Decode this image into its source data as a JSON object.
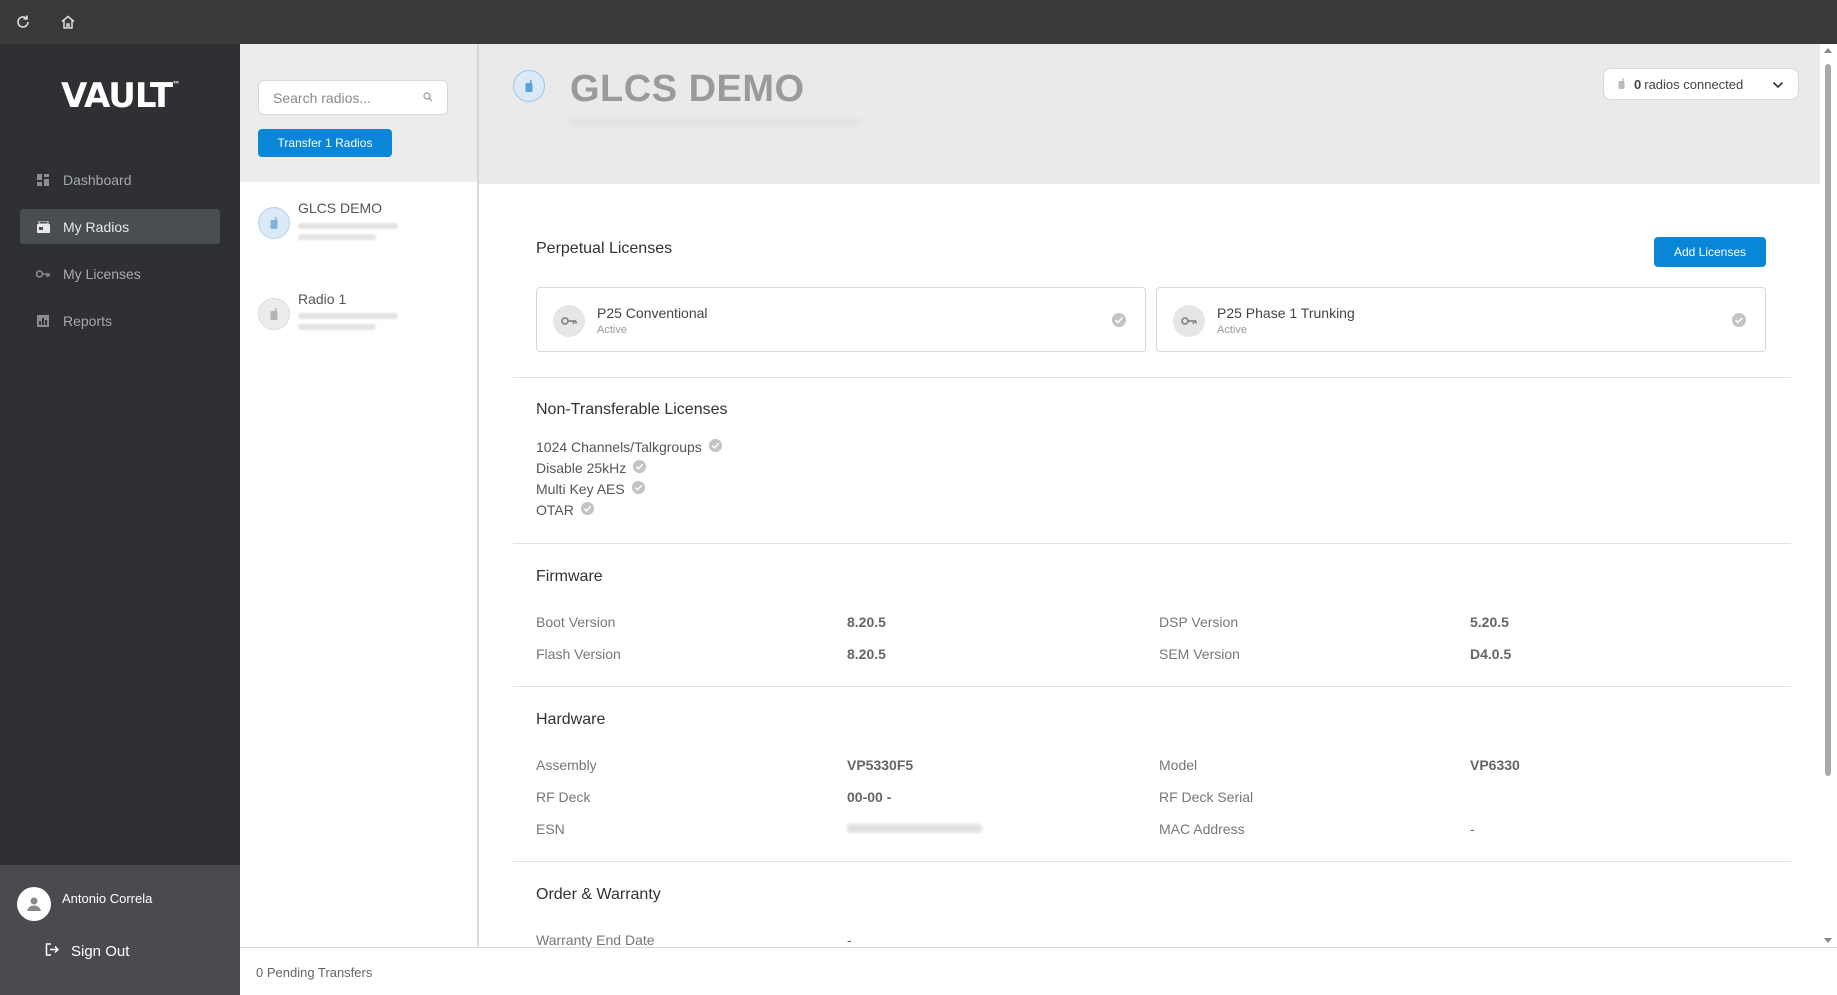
{
  "sidebar": {
    "logo": "VAULT",
    "logo_tm": "™",
    "items": [
      {
        "label": "Dashboard",
        "icon": "dashboard-icon"
      },
      {
        "label": "My Radios",
        "icon": "radio-icon",
        "active": true
      },
      {
        "label": "My Licenses",
        "icon": "key-icon"
      },
      {
        "label": "Reports",
        "icon": "reports-icon"
      }
    ],
    "user": {
      "name": "Antonio Correla"
    },
    "signout_label": "Sign Out"
  },
  "list": {
    "search_placeholder": "Search radios...",
    "transfer_label": "Transfer 1 Radios",
    "radios": [
      {
        "name": "GLCS DEMO",
        "selected": true
      },
      {
        "name": "Radio 1",
        "selected": false
      }
    ]
  },
  "footer": {
    "pending_label": "0 Pending Transfers"
  },
  "header": {
    "title": "GLCS DEMO",
    "connected_count": "0",
    "connected_label": "radios connected"
  },
  "perpetual": {
    "title": "Perpetual Licenses",
    "add_label": "Add Licenses",
    "cards": [
      {
        "name": "P25 Conventional",
        "status": "Active"
      },
      {
        "name": "P25 Phase 1 Trunking",
        "status": "Active"
      }
    ]
  },
  "non_transferable": {
    "title": "Non-Transferable Licenses",
    "items": [
      "1024 Channels/Talkgroups",
      "Disable 25kHz",
      "Multi Key AES",
      "OTAR"
    ]
  },
  "firmware": {
    "title": "Firmware",
    "boot_label": "Boot Version",
    "boot_value": "8.20.5",
    "dsp_label": "DSP Version",
    "dsp_value": "5.20.5",
    "flash_label": "Flash Version",
    "flash_value": "8.20.5",
    "sem_label": "SEM Version",
    "sem_value": "D4.0.5"
  },
  "hardware": {
    "title": "Hardware",
    "assembly_label": "Assembly",
    "assembly_value": "VP5330F5",
    "model_label": "Model",
    "model_value": "VP6330",
    "rfdeck_label": "RF Deck",
    "rfdeck_value": "00-00 -",
    "rfserial_label": "RF Deck Serial",
    "rfserial_value": "",
    "esn_label": "ESN",
    "mac_label": "MAC Address",
    "mac_value": "-"
  },
  "warranty": {
    "title": "Order & Warranty",
    "end_label": "Warranty End Date",
    "end_value": "-"
  },
  "colors": {
    "accent": "#0a86d8",
    "sidebar": "#2e3033",
    "topbar": "#3a3a3a"
  }
}
